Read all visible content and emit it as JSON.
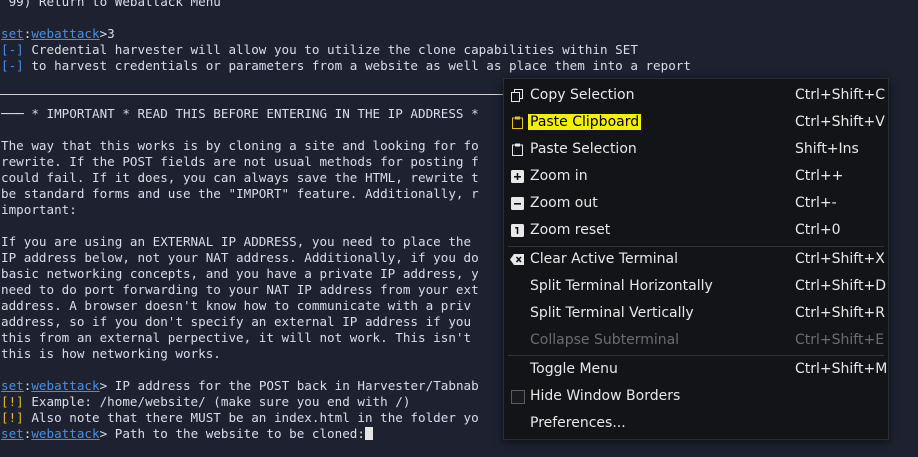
{
  "terminal": {
    "line_top": " 99) Return to Webattack Menu",
    "prompt1": {
      "set": "set",
      "colon": ":",
      "module": "webattack",
      "rest": ">3"
    },
    "info1": {
      "bracket": "[-]",
      "text": " Credential harvester will allow you to utilize the clone capabilities within SET"
    },
    "info2": {
      "bracket": "[-]",
      "text": " to harvest credentials or parameters from a website as well as place them into a report"
    },
    "important": "─── * IMPORTANT * READ THIS BEFORE ENTERING IN THE IP ADDRESS *",
    "para1": [
      "The way that this works is by cloning a site and looking for fo",
      "rewrite. If the POST fields are not usual methods for posting f",
      "could fail. If it does, you can always save the HTML, rewrite t",
      "be standard forms and use the \"IMPORT\" feature. Additionally, r",
      "important:"
    ],
    "para2": [
      "If you are using an EXTERNAL IP ADDRESS, you need to place the",
      "IP address below, not your NAT address. Additionally, if you do",
      "basic networking concepts, and you have a private IP address, y",
      "need to do port forwarding to your NAT IP address from your ext",
      "address. A browser doesn't know how to communicate with a priv",
      "address, so if you don't specify an external IP address if you",
      "this from an external perpective, it will not work. This isn't",
      "this is how networking works."
    ],
    "prompt2": {
      "set": "set",
      "colon": ":",
      "module": "webattack",
      "rest": "> IP address for the POST back in Harvester/Tabnab"
    },
    "warn1": {
      "bracket": "[!]",
      "text": " Example: /home/website/ (make sure you end with /)"
    },
    "warn2": {
      "bracket": "[!]",
      "text": " Also note that there MUST be an index.html in the folder yo"
    },
    "prompt3": {
      "set": "set",
      "colon": ":",
      "module": "webattack",
      "rest": "> Path to the website to be cloned:"
    }
  },
  "menu": {
    "items": [
      {
        "label": "Copy Selection",
        "shortcut": "Ctrl+Shift+C",
        "icon": "copy-icon"
      },
      {
        "label": "Paste Clipboard",
        "shortcut": "Ctrl+Shift+V",
        "icon": "clipboard-icon",
        "highlight_color": "#f4f000"
      },
      {
        "label": "Paste Selection",
        "shortcut": "Shift+Ins",
        "icon": "paste-icon"
      },
      {
        "label": "Zoom in",
        "shortcut": "Ctrl++",
        "icon": "zoom-in-icon"
      },
      {
        "label": "Zoom out",
        "shortcut": "Ctrl+-",
        "icon": "zoom-out-icon"
      },
      {
        "label": "Zoom reset",
        "shortcut": "Ctrl+0",
        "icon": "zoom-reset-icon"
      },
      {
        "label": "Clear Active Terminal",
        "shortcut": "Ctrl+Shift+X",
        "icon": "clear-icon"
      },
      {
        "label": "Split Terminal Horizontally",
        "shortcut": "Ctrl+Shift+D"
      },
      {
        "label": "Split Terminal Vertically",
        "shortcut": "Ctrl+Shift+R"
      },
      {
        "label": "Collapse Subterminal",
        "shortcut": "Ctrl+Shift+E",
        "disabled": true
      },
      {
        "label": "Toggle Menu",
        "shortcut": "Ctrl+Shift+M"
      },
      {
        "label": "Hide Window Borders",
        "icon": "checkbox-icon"
      },
      {
        "label": "Preferences..."
      }
    ]
  },
  "colors": {
    "background": "#1e2230",
    "prompt_blue": "#4a8fe0",
    "warn_yellow": "#e0b830",
    "menu_bg": "#131417"
  }
}
